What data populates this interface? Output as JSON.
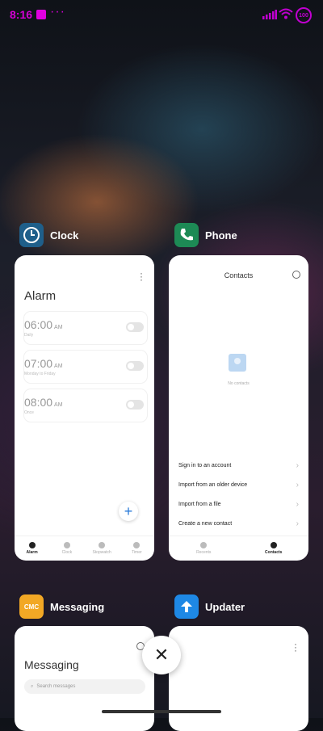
{
  "status_bar": {
    "time": "8:16",
    "notif_dots": "···",
    "battery": "100"
  },
  "apps": [
    {
      "name": "Clock",
      "icon": "clock-icon",
      "color": "#1f5f8a",
      "preview": {
        "title": "Alarm",
        "alarms": [
          {
            "time": "06:00",
            "ampm": "AM",
            "sub": "Daily"
          },
          {
            "time": "07:00",
            "ampm": "AM",
            "sub": "Monday to Friday"
          },
          {
            "time": "08:00",
            "ampm": "AM",
            "sub": "Once"
          }
        ],
        "nav": [
          "Alarm",
          "Clock",
          "Stopwatch",
          "Timer"
        ],
        "fab": "+"
      }
    },
    {
      "name": "Phone",
      "icon": "phone-icon",
      "color": "#1d8a55",
      "preview": {
        "title": "Contacts",
        "empty": "No contacts",
        "menu": [
          "Sign in to an account",
          "Import from an older device",
          "Import from a file",
          "Create a new contact"
        ],
        "nav": [
          "Recents",
          "Contacts"
        ]
      }
    },
    {
      "name": "Messaging",
      "icon": "cmc-icon",
      "icon_text": "CMC",
      "color": "#f2a825",
      "preview": {
        "title": "Messaging",
        "search_placeholder": "Search messages"
      }
    },
    {
      "name": "Updater",
      "icon": "arrow-up-icon",
      "color": "#1e88e5"
    }
  ],
  "close_glyph": "✕"
}
